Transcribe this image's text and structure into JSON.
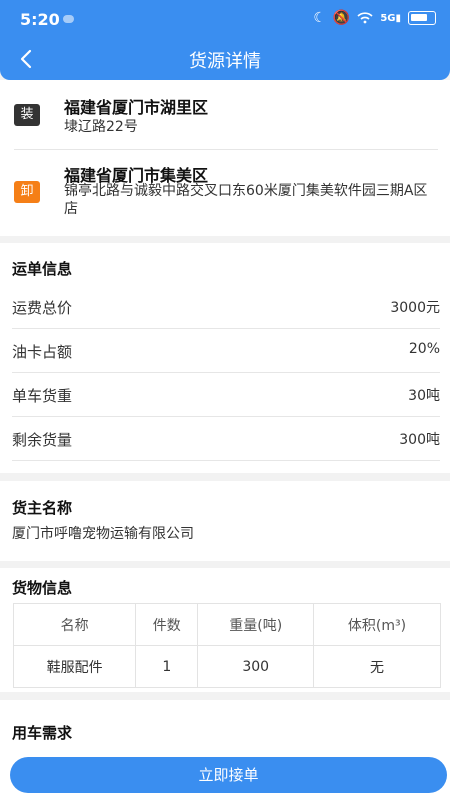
{
  "status_bar": {
    "time": "5:20",
    "network": "5G"
  },
  "nav": {
    "title": "货源详情"
  },
  "loading": {
    "tag": "装",
    "city": "福建省厦门市湖里区",
    "street": "埭辽路22号"
  },
  "unloading": {
    "tag": "卸",
    "city": "福建省厦门市集美区",
    "street": "锦亭北路与诚毅中路交叉口东60米厦门集美软件园三期A区店"
  },
  "waybill": {
    "title": "运单信息",
    "rows": [
      {
        "label": "运费总价",
        "value": "3000元"
      },
      {
        "label": "油卡占额",
        "value": "20%"
      },
      {
        "label": "单车货重",
        "value": "30吨"
      },
      {
        "label": "剩余货量",
        "value": "300吨"
      }
    ]
  },
  "owner": {
    "title": "货主名称",
    "name": "厦门市呼噜宠物运输有限公司"
  },
  "goods": {
    "title": "货物信息",
    "headers": [
      "名称",
      "件数",
      "重量(吨)",
      "体积(m³)"
    ],
    "rows": [
      [
        "鞋服配件",
        "1",
        "300",
        "无"
      ]
    ]
  },
  "vehicle_need": {
    "title": "用车需求"
  },
  "actions": {
    "accept_label": "立即接单"
  },
  "colors": {
    "primary": "#3a8ef0",
    "unload_tag": "#f57f17",
    "load_tag": "#333333"
  }
}
